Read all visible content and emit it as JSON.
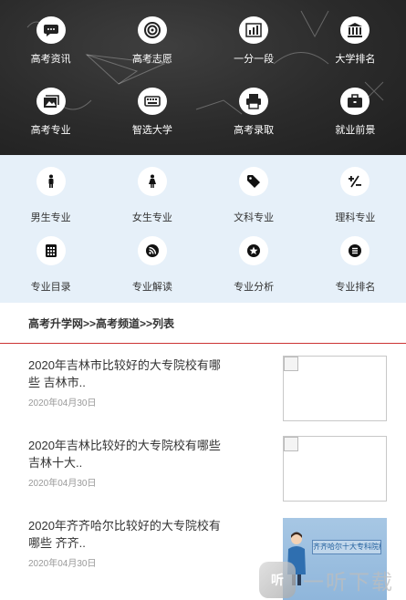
{
  "top_nav": [
    {
      "label": "高考资讯",
      "icon": "chat-bubble-icon"
    },
    {
      "label": "高考志愿",
      "icon": "target-icon"
    },
    {
      "label": "一分一段",
      "icon": "bar-chart-icon"
    },
    {
      "label": "大学排名",
      "icon": "university-building-icon"
    },
    {
      "label": "高考专业",
      "icon": "photo-stack-icon"
    },
    {
      "label": "智选大学",
      "icon": "keyboard-icon"
    },
    {
      "label": "高考录取",
      "icon": "printer-icon"
    },
    {
      "label": "就业前景",
      "icon": "briefcase-icon"
    }
  ],
  "categories": [
    {
      "label": "男生专业",
      "icon": "male-figure-icon"
    },
    {
      "label": "女生专业",
      "icon": "female-figure-icon"
    },
    {
      "label": "文科专业",
      "icon": "tag-icon"
    },
    {
      "label": "理科专业",
      "icon": "plus-minus-icon"
    },
    {
      "label": "专业目录",
      "icon": "grid-calculator-icon"
    },
    {
      "label": "专业解读",
      "icon": "rss-icon"
    },
    {
      "label": "专业分析",
      "icon": "star-badge-icon"
    },
    {
      "label": "专业排名",
      "icon": "stack-list-icon"
    }
  ],
  "breadcrumb": {
    "text": "高考升学网>>高考频道>>列表"
  },
  "articles": [
    {
      "title": "2020年吉林市比较好的大专院校有哪些 吉林市..",
      "date": "2020年04月30日"
    },
    {
      "title": "2020年吉林比较好的大专院校有哪些 吉林十大..",
      "date": "2020年04月30日"
    },
    {
      "title": "2020年齐齐哈尔比较好的大专院校有哪些 齐齐..",
      "date": "2020年04月30日",
      "thumb_caption": "齐齐哈尔十大专科院校排名"
    }
  ],
  "watermark": {
    "logo": "听",
    "text": "一听下载"
  },
  "colors": {
    "top_bg": "#2b2b2b",
    "category_bg": "#e6f0f9",
    "divider": "#cc3333",
    "date": "#999999"
  }
}
